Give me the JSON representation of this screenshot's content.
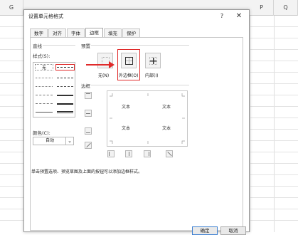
{
  "sheet": {
    "columns": [
      "G",
      "P",
      "Q"
    ]
  },
  "dialog": {
    "title": "设置单元格格式",
    "help": "?",
    "close": "✕",
    "tabs": [
      "数字",
      "对齐",
      "字体",
      "边框",
      "填充",
      "保护"
    ],
    "active_tab": "边框",
    "line_group": {
      "label": "直线",
      "style_label": "样式(S):",
      "none_label": "无",
      "color_label": "颜色(C):",
      "color_value": "自动"
    },
    "presets_group": {
      "label": "预置",
      "items": [
        "无(N)",
        "外边框(O)",
        "内部(I)"
      ]
    },
    "border_group": {
      "label": "边框",
      "preview_text": [
        "文本",
        "文本",
        "文本",
        "文本"
      ]
    },
    "hint": "单击预置选项、预览草图及上面的按钮可以添加边框样式。",
    "buttons": {
      "ok": "确定",
      "cancel": "取消"
    }
  },
  "colors": {
    "highlight": "#e02a2a",
    "accent": "#3c7fd1"
  }
}
